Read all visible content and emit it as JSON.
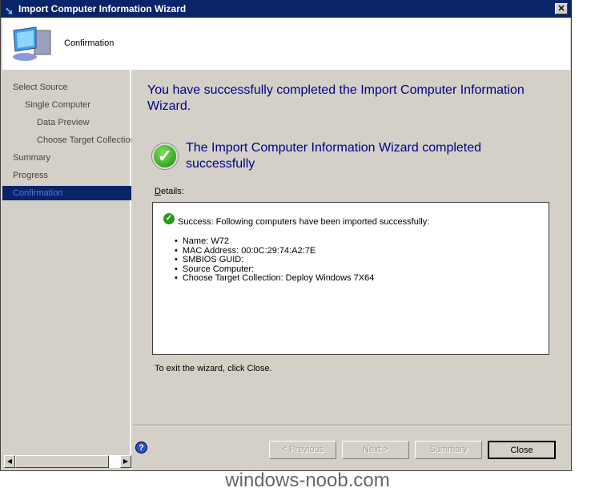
{
  "window": {
    "title": "Import Computer Information Wizard",
    "close_label": "✕"
  },
  "header": {
    "title": "Confirmation"
  },
  "sidebar": {
    "items": [
      {
        "label": "Select Source",
        "level": 0
      },
      {
        "label": "Single Computer",
        "level": 1
      },
      {
        "label": "Data Preview",
        "level": 2
      },
      {
        "label": "Choose Target Collection",
        "level": 2
      },
      {
        "label": "Summary",
        "level": 0
      },
      {
        "label": "Progress",
        "level": 0
      },
      {
        "label": "Confirmation",
        "level": 0,
        "active": true
      }
    ]
  },
  "main": {
    "headline": "You have successfully completed the Import Computer Information Wizard.",
    "status": "The Import Computer Information Wizard completed successfully",
    "details_label": "Details:",
    "success_text": "Success: Following computers have been imported successfully:",
    "items": [
      "Name: W72",
      "MAC Address: 00:0C:29:74:A2:7E",
      "SMBIOS GUID:",
      "Source Computer:",
      "Choose Target Collection: Deploy Windows 7X64"
    ],
    "exit_text": "To exit the wizard, click Close."
  },
  "buttons": {
    "previous": "< Previous",
    "next": "Next >",
    "summary": "Summary",
    "close": "Close"
  },
  "watermark": "windows-noob.com"
}
